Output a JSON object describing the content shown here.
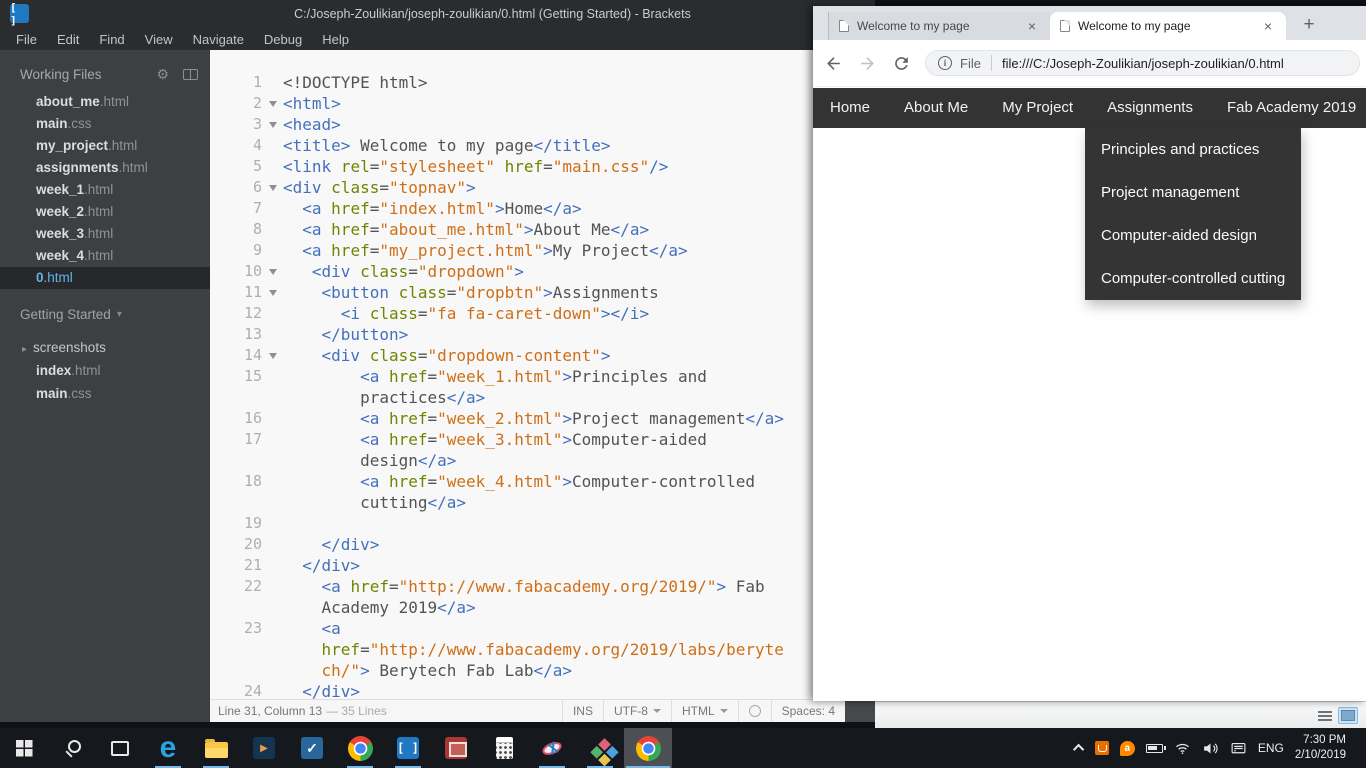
{
  "icons": {
    "close": "×",
    "new_tab": "+",
    "gear": "⚙",
    "caret_down": "▾",
    "tri_right": "▸",
    "brackets_logo": "[ ]",
    "edge_glyph": "e",
    "todo_check": "✓",
    "movies_play": "▶",
    "avast_glyph": "a",
    "info_glyph": "i"
  },
  "brackets": {
    "title": "C:/Joseph-Zoulikian/joseph-zoulikian/0.html (Getting Started) - Brackets",
    "menu": [
      "File",
      "Edit",
      "Find",
      "View",
      "Navigate",
      "Debug",
      "Help"
    ],
    "sidebar": {
      "working_files_label": "Working Files",
      "files": [
        {
          "base": "about_me",
          "ext": ".html",
          "selected": false
        },
        {
          "base": "main",
          "ext": ".css",
          "selected": false
        },
        {
          "base": "my_project",
          "ext": ".html",
          "selected": false
        },
        {
          "base": "assignments",
          "ext": ".html",
          "selected": false
        },
        {
          "base": "week_1",
          "ext": ".html",
          "selected": false
        },
        {
          "base": "week_2",
          "ext": ".html",
          "selected": false
        },
        {
          "base": "week_3",
          "ext": ".html",
          "selected": false
        },
        {
          "base": "week_4",
          "ext": ".html",
          "selected": false
        },
        {
          "base": "0",
          "ext": ".html",
          "selected": true
        }
      ],
      "project_label": "Getting Started",
      "tree": [
        {
          "type": "folder",
          "label": "screenshots"
        },
        {
          "type": "file",
          "base": "index",
          "ext": ".html"
        },
        {
          "type": "file",
          "base": "main",
          "ext": ".css"
        }
      ]
    },
    "editor_rows": [
      {
        "n": "1",
        "seg": [
          [
            "p",
            "<!DOCTYPE html>"
          ]
        ]
      },
      {
        "n": "2",
        "fold": true,
        "seg": [
          [
            "t",
            "<html>"
          ]
        ]
      },
      {
        "n": "3",
        "fold": true,
        "seg": [
          [
            "t",
            "<head>"
          ]
        ]
      },
      {
        "n": "4",
        "seg": [
          [
            "t",
            "<title>"
          ],
          [
            "p",
            " Welcome to my page"
          ],
          [
            "t",
            "</title>"
          ]
        ]
      },
      {
        "n": "5",
        "seg": [
          [
            "t",
            "<link"
          ],
          [
            "p",
            " "
          ],
          [
            "a",
            "rel"
          ],
          [
            "p",
            "="
          ],
          [
            "s",
            "\"stylesheet\""
          ],
          [
            "p",
            " "
          ],
          [
            "a",
            "href"
          ],
          [
            "p",
            "="
          ],
          [
            "s",
            "\"main.css\""
          ],
          [
            "t",
            "/>"
          ]
        ]
      },
      {
        "n": "6",
        "fold": true,
        "seg": [
          [
            "t",
            "<div"
          ],
          [
            "p",
            " "
          ],
          [
            "a",
            "class"
          ],
          [
            "p",
            "="
          ],
          [
            "s",
            "\"topnav\""
          ],
          [
            "t",
            ">"
          ]
        ]
      },
      {
        "n": "7",
        "seg": [
          [
            "p",
            "  "
          ],
          [
            "t",
            "<a"
          ],
          [
            "p",
            " "
          ],
          [
            "a",
            "href"
          ],
          [
            "p",
            "="
          ],
          [
            "s",
            "\"index.html\""
          ],
          [
            "t",
            ">"
          ],
          [
            "p",
            "Home"
          ],
          [
            "t",
            "</a>"
          ]
        ]
      },
      {
        "n": "8",
        "seg": [
          [
            "p",
            "  "
          ],
          [
            "t",
            "<a"
          ],
          [
            "p",
            " "
          ],
          [
            "a",
            "href"
          ],
          [
            "p",
            "="
          ],
          [
            "s",
            "\"about_me.html\""
          ],
          [
            "t",
            ">"
          ],
          [
            "p",
            "About Me"
          ],
          [
            "t",
            "</a>"
          ]
        ]
      },
      {
        "n": "9",
        "seg": [
          [
            "p",
            "  "
          ],
          [
            "t",
            "<a"
          ],
          [
            "p",
            " "
          ],
          [
            "a",
            "href"
          ],
          [
            "p",
            "="
          ],
          [
            "s",
            "\"my_project.html\""
          ],
          [
            "t",
            ">"
          ],
          [
            "p",
            "My Project"
          ],
          [
            "t",
            "</a>"
          ]
        ]
      },
      {
        "n": "10",
        "fold": true,
        "seg": [
          [
            "p",
            "   "
          ],
          [
            "t",
            "<div"
          ],
          [
            "p",
            " "
          ],
          [
            "a",
            "class"
          ],
          [
            "p",
            "="
          ],
          [
            "s",
            "\"dropdown\""
          ],
          [
            "t",
            ">"
          ]
        ]
      },
      {
        "n": "11",
        "fold": true,
        "seg": [
          [
            "p",
            "    "
          ],
          [
            "t",
            "<button"
          ],
          [
            "p",
            " "
          ],
          [
            "a",
            "class"
          ],
          [
            "p",
            "="
          ],
          [
            "s",
            "\"dropbtn\""
          ],
          [
            "t",
            ">"
          ],
          [
            "p",
            "Assignments"
          ]
        ]
      },
      {
        "n": "12",
        "seg": [
          [
            "p",
            "      "
          ],
          [
            "t",
            "<i"
          ],
          [
            "p",
            " "
          ],
          [
            "a",
            "class"
          ],
          [
            "p",
            "="
          ],
          [
            "s",
            "\"fa fa-caret-down\""
          ],
          [
            "t",
            "></i>"
          ]
        ]
      },
      {
        "n": "13",
        "seg": [
          [
            "p",
            "    "
          ],
          [
            "t",
            "</button>"
          ]
        ]
      },
      {
        "n": "14",
        "fold": true,
        "seg": [
          [
            "p",
            "    "
          ],
          [
            "t",
            "<div"
          ],
          [
            "p",
            " "
          ],
          [
            "a",
            "class"
          ],
          [
            "p",
            "="
          ],
          [
            "s",
            "\"dropdown-content\""
          ],
          [
            "t",
            ">"
          ]
        ]
      },
      {
        "n": "15",
        "seg": [
          [
            "p",
            "        "
          ],
          [
            "t",
            "<a"
          ],
          [
            "p",
            " "
          ],
          [
            "a",
            "href"
          ],
          [
            "p",
            "="
          ],
          [
            "s",
            "\"week_1.html\""
          ],
          [
            "t",
            ">"
          ],
          [
            "p",
            "Principles and"
          ]
        ]
      },
      {
        "n": "",
        "seg": [
          [
            "p",
            "        practices"
          ],
          [
            "t",
            "</a>"
          ]
        ]
      },
      {
        "n": "16",
        "seg": [
          [
            "p",
            "        "
          ],
          [
            "t",
            "<a"
          ],
          [
            "p",
            " "
          ],
          [
            "a",
            "href"
          ],
          [
            "p",
            "="
          ],
          [
            "s",
            "\"week_2.html\""
          ],
          [
            "t",
            ">"
          ],
          [
            "p",
            "Project management"
          ],
          [
            "t",
            "</a>"
          ]
        ]
      },
      {
        "n": "17",
        "seg": [
          [
            "p",
            "        "
          ],
          [
            "t",
            "<a"
          ],
          [
            "p",
            " "
          ],
          [
            "a",
            "href"
          ],
          [
            "p",
            "="
          ],
          [
            "s",
            "\"week_3.html\""
          ],
          [
            "t",
            ">"
          ],
          [
            "p",
            "Computer-aided"
          ]
        ]
      },
      {
        "n": "",
        "seg": [
          [
            "p",
            "        design"
          ],
          [
            "t",
            "</a>"
          ]
        ]
      },
      {
        "n": "18",
        "seg": [
          [
            "p",
            "        "
          ],
          [
            "t",
            "<a"
          ],
          [
            "p",
            " "
          ],
          [
            "a",
            "href"
          ],
          [
            "p",
            "="
          ],
          [
            "s",
            "\"week_4.html\""
          ],
          [
            "t",
            ">"
          ],
          [
            "p",
            "Computer-controlled"
          ]
        ]
      },
      {
        "n": "",
        "seg": [
          [
            "p",
            "        cutting"
          ],
          [
            "t",
            "</a>"
          ]
        ]
      },
      {
        "n": "19",
        "seg": []
      },
      {
        "n": "20",
        "seg": [
          [
            "p",
            "    "
          ],
          [
            "t",
            "</div>"
          ]
        ]
      },
      {
        "n": "21",
        "seg": [
          [
            "p",
            "  "
          ],
          [
            "t",
            "</div>"
          ]
        ]
      },
      {
        "n": "22",
        "seg": [
          [
            "p",
            "    "
          ],
          [
            "t",
            "<a"
          ],
          [
            "p",
            " "
          ],
          [
            "a",
            "href"
          ],
          [
            "p",
            "="
          ],
          [
            "s",
            "\"http://www.fabacademy.org/2019/\""
          ],
          [
            "t",
            ">"
          ],
          [
            "p",
            " Fab"
          ]
        ]
      },
      {
        "n": "",
        "seg": [
          [
            "p",
            "    Academy 2019"
          ],
          [
            "t",
            "</a>"
          ]
        ]
      },
      {
        "n": "23",
        "seg": [
          [
            "p",
            "    "
          ],
          [
            "t",
            "<a"
          ]
        ]
      },
      {
        "n": "",
        "seg": [
          [
            "p",
            "    "
          ],
          [
            "a",
            "href"
          ],
          [
            "p",
            "="
          ],
          [
            "s",
            "\"http://www.fabacademy.org/2019/labs/beryte"
          ]
        ]
      },
      {
        "n": "",
        "seg": [
          [
            "p",
            "    "
          ],
          [
            "s",
            "ch/\""
          ],
          [
            "t",
            ">"
          ],
          [
            "p",
            " Berytech Fab Lab"
          ],
          [
            "t",
            "</a>"
          ]
        ]
      },
      {
        "n": "24",
        "seg": [
          [
            "p",
            "  "
          ],
          [
            "t",
            "</div>"
          ]
        ]
      }
    ],
    "status": {
      "position": "Line 31, Column 13",
      "lines": "— 35 Lines",
      "overwrite": "INS",
      "encoding": "UTF-8",
      "language": "HTML",
      "spaces": "Spaces: 4"
    }
  },
  "chrome": {
    "tabs": [
      {
        "title": "Welcome to my page",
        "active": false
      },
      {
        "title": "Welcome to my page",
        "active": true
      }
    ],
    "url_chip": "File",
    "url": "file:///C:/Joseph-Zoulikian/joseph-zoulikian/0.html",
    "page": {
      "nav": [
        "Home",
        "About Me",
        "My Project",
        "Assignments",
        "Fab Academy 2019"
      ],
      "dropdown": [
        "Principles and practices",
        "Project management",
        "Computer-aided design",
        "Computer-controlled cutting"
      ]
    }
  },
  "taskbar": {
    "items": [
      {
        "icon": "start",
        "running": false,
        "active": false
      },
      {
        "icon": "search",
        "running": false,
        "active": false
      },
      {
        "icon": "task-view",
        "running": false,
        "active": false
      },
      {
        "icon": "edge",
        "running": true,
        "active": false
      },
      {
        "icon": "explorer",
        "running": true,
        "active": false
      },
      {
        "icon": "movies",
        "running": false,
        "active": false
      },
      {
        "icon": "todo",
        "running": false,
        "active": false
      },
      {
        "icon": "chrome",
        "running": true,
        "active": false
      },
      {
        "icon": "brackets",
        "running": true,
        "active": false
      },
      {
        "icon": "pictures",
        "running": false,
        "active": false
      },
      {
        "icon": "calculator",
        "running": false,
        "active": false
      },
      {
        "icon": "snipping",
        "running": true,
        "active": false
      },
      {
        "icon": "design",
        "running": true,
        "active": false
      },
      {
        "icon": "chrome",
        "running": true,
        "active": true
      }
    ],
    "tray": {
      "language": "ENG",
      "time": "7:30 PM",
      "date": "2/10/2019"
    }
  }
}
